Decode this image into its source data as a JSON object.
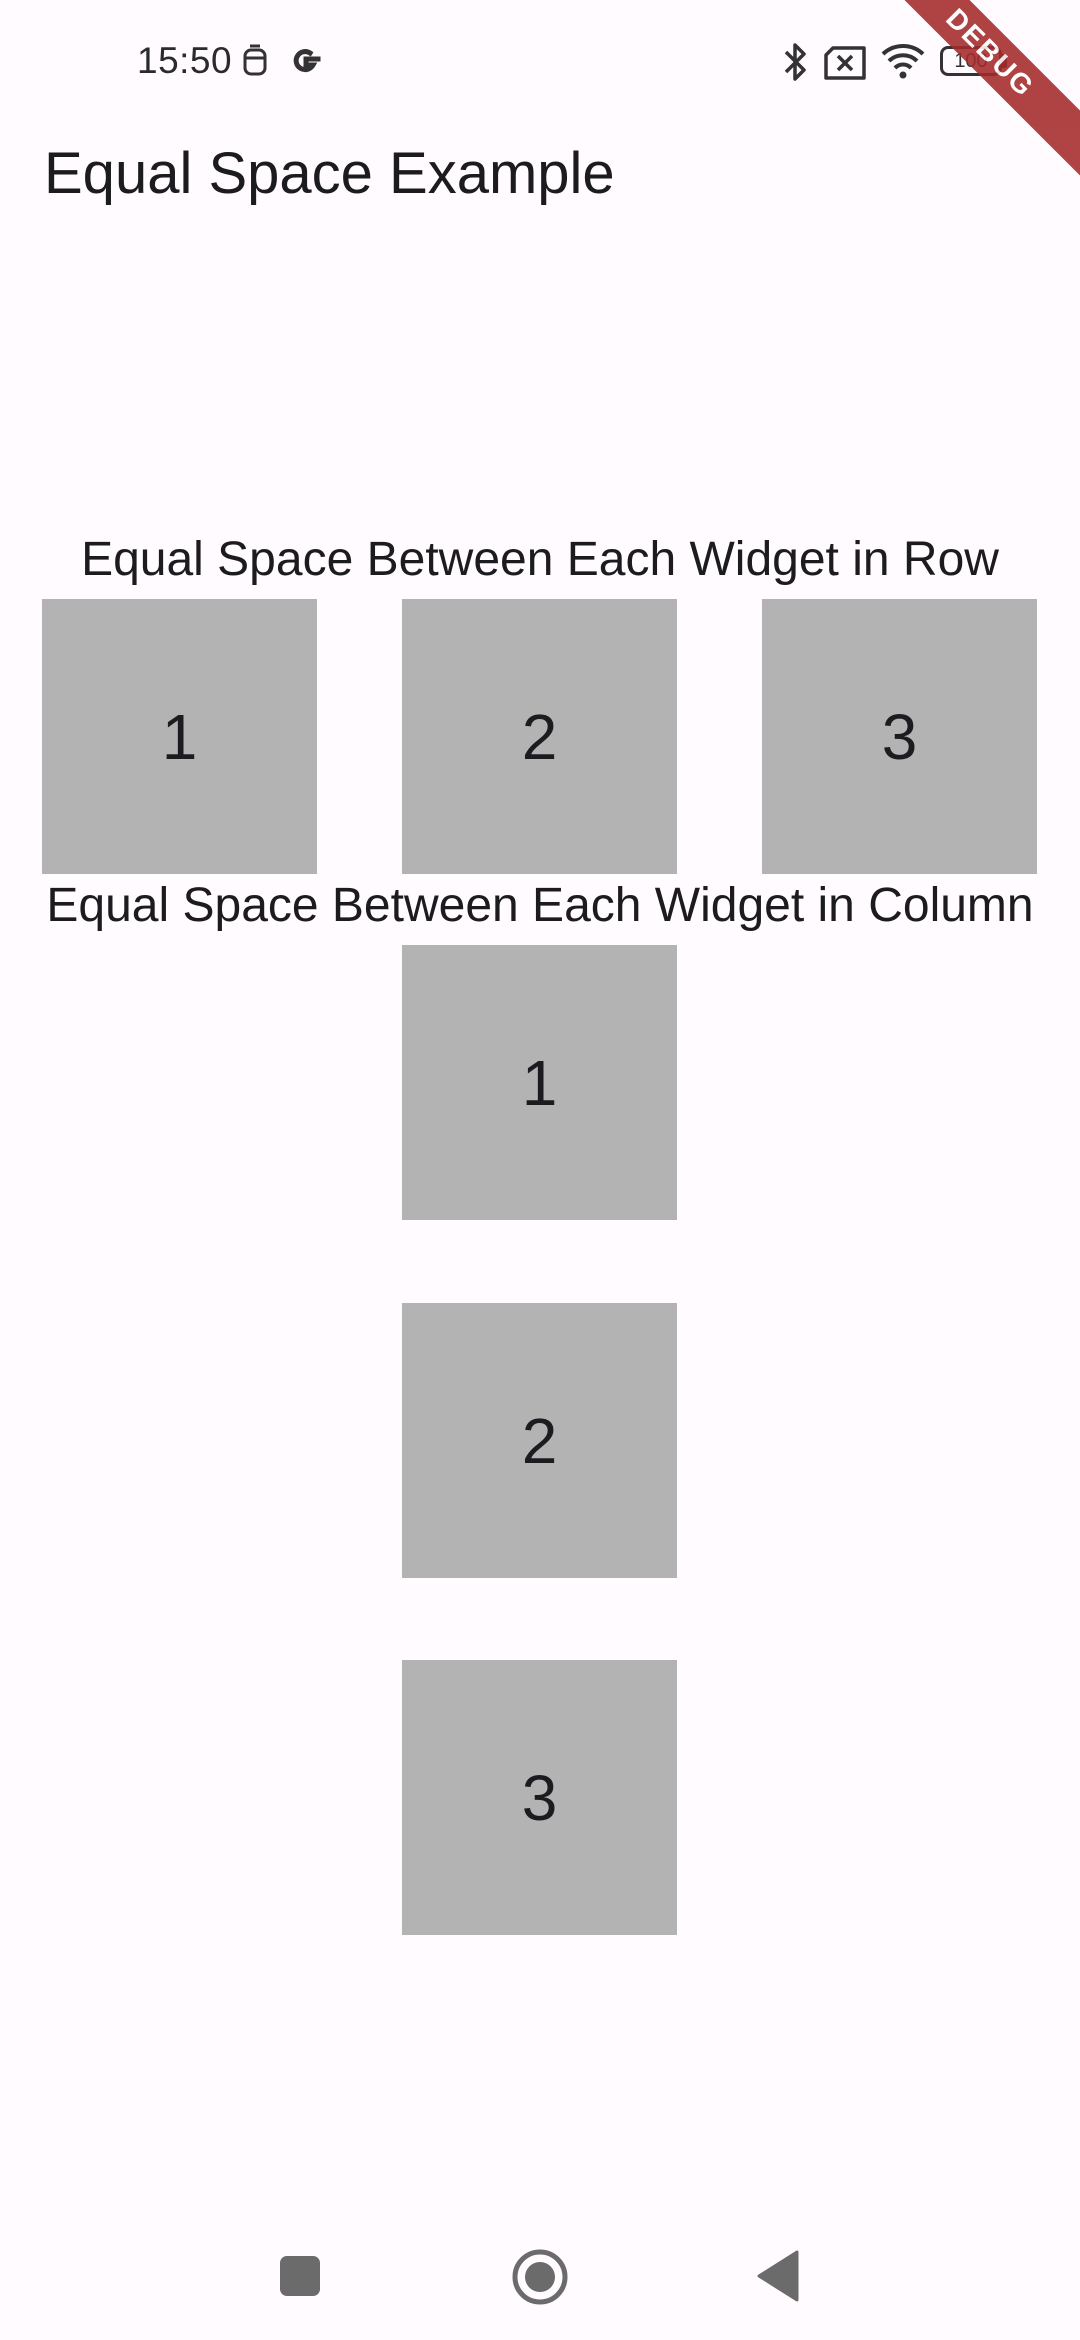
{
  "status_bar": {
    "time": "15:50",
    "battery": "100",
    "icons": [
      "notification-icon",
      "google-icon",
      "bluetooth-icon",
      "sim-error-icon",
      "wifi-icon",
      "battery-icon"
    ]
  },
  "debug_banner": "DEBUG",
  "app_bar": {
    "title": "Equal Space Example"
  },
  "row_section": {
    "title": "Equal Space Between Each Widget in Row",
    "items": [
      "1",
      "2",
      "3"
    ]
  },
  "column_section": {
    "title": "Equal Space Between Each Widget in Column",
    "items": [
      "1",
      "2",
      "3"
    ]
  },
  "colors": {
    "background": "#fffbfe",
    "box": "#b3b3b3",
    "text": "#1c1b1f",
    "debug_banner": "#a52a2a"
  },
  "nav_bar": {
    "buttons": [
      "recents-button",
      "home-button",
      "back-button"
    ]
  }
}
